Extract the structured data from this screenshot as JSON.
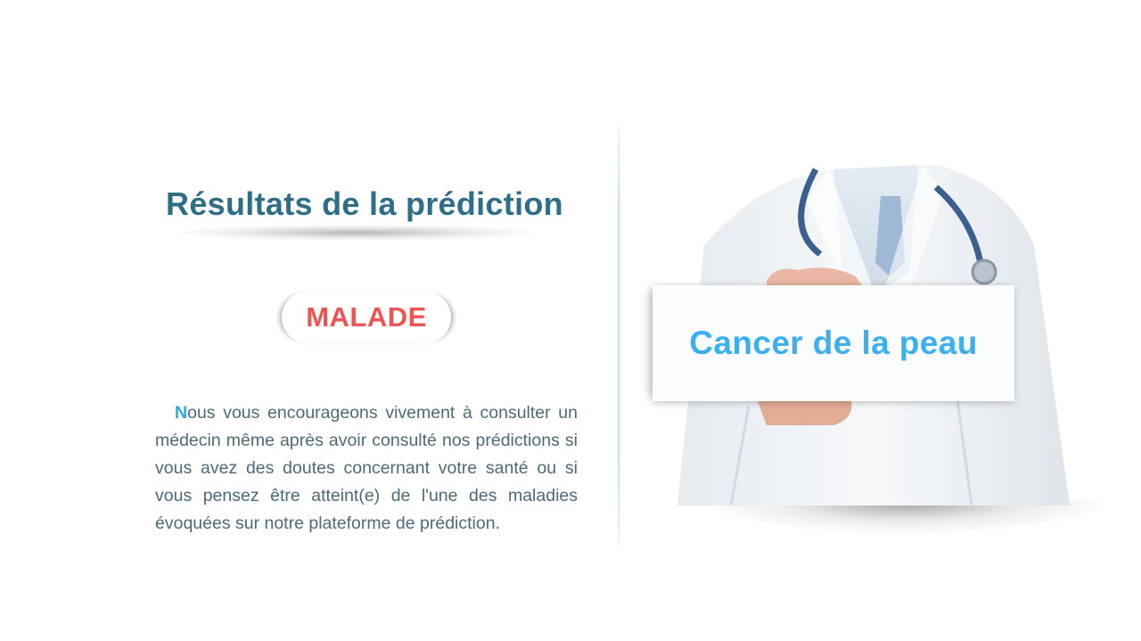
{
  "results": {
    "title": "Résultats de la prédiction",
    "status": "MALADE",
    "message_initial": "N",
    "message_rest": "ous vous encourageons vivement à consulter un médecin même après avoir consulté nos prédictions si vous avez des doutes concernant votre santé ou si vous pensez être atteint(e) de l'une des maladies évoquées sur notre plateforme de prédiction."
  },
  "illustration": {
    "sign_text": "Cancer de la peau"
  },
  "colors": {
    "title": "#2e6e86",
    "status": "#ef5454",
    "accent": "#2aa7df",
    "sign_text": "#3cb0ee"
  }
}
